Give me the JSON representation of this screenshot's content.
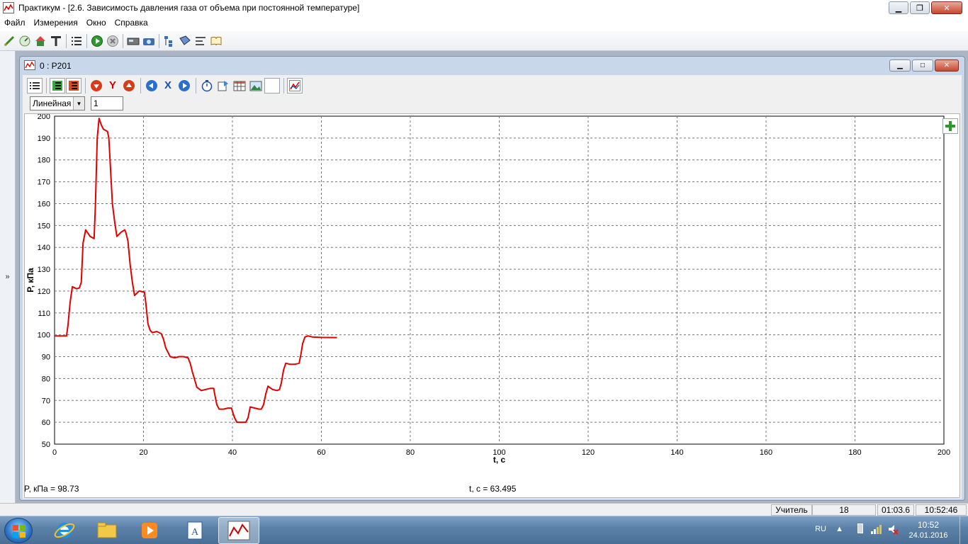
{
  "window": {
    "title": "Практикум - [2.6. Зависимость давления газа от объема при постоянной температуре]"
  },
  "menu": [
    "Файл",
    "Измерения",
    "Окно",
    "Справка"
  ],
  "leftbar": {
    "expand_label": "»"
  },
  "child": {
    "title": "0 : P201",
    "scale_select": "Линейная",
    "scale_value": "1"
  },
  "colors": {
    "line": "#e00000",
    "mdi_bg": "#abb5c3",
    "child_frame": "#c8d7ea"
  },
  "chart_data": {
    "type": "line",
    "xlabel": "t, c",
    "ylabel": "P, кПа",
    "xlim": [
      0,
      200
    ],
    "ylim": [
      50,
      200
    ],
    "grid": true,
    "x_ticks": [
      0,
      20,
      40,
      60,
      80,
      100,
      120,
      140,
      160,
      180,
      200
    ],
    "y_ticks": [
      50,
      60,
      70,
      80,
      90,
      100,
      110,
      120,
      130,
      140,
      150,
      160,
      170,
      180,
      190,
      200
    ],
    "series": [
      {
        "color": "#e00000",
        "x": [
          0,
          2.7,
          3,
          3.5,
          4,
          5,
          5.6,
          6,
          6.4,
          7,
          8,
          8.9,
          9.2,
          9.6,
          10,
          10.5,
          11,
          11.9,
          12.2,
          12.6,
          13,
          13.5,
          14,
          15,
          15.8,
          16,
          16.5,
          17,
          17.5,
          18,
          18.5,
          19,
          20.2,
          20.5,
          21,
          21.5,
          22,
          23,
          24,
          24.5,
          25,
          26,
          27,
          28,
          29,
          30,
          30.5,
          31,
          32,
          33,
          34,
          35,
          35.8,
          36,
          36.5,
          37,
          38,
          39,
          39.8,
          40,
          40.5,
          41,
          42,
          43,
          43.5,
          44,
          45,
          46,
          46.5,
          47,
          47.5,
          48,
          49,
          50,
          50.6,
          51,
          51.5,
          52,
          53,
          54,
          55,
          55.4,
          55.8,
          56.3,
          57,
          58,
          60,
          63.5
        ],
        "y": [
          99.5,
          99.5,
          104,
          115,
          122,
          121,
          121.5,
          124,
          142,
          148,
          145,
          144,
          160,
          190,
          199,
          196,
          194,
          193,
          190,
          175,
          160,
          152,
          145,
          147,
          148,
          147,
          143,
          132,
          124,
          118,
          119,
          120,
          119.5,
          115,
          105,
          102,
          101,
          101.5,
          100.5,
          98,
          94,
          90,
          89.5,
          90,
          90,
          89.5,
          87,
          83,
          76,
          74.5,
          75,
          75.5,
          75.5,
          73,
          68,
          66,
          66,
          66.5,
          66.5,
          65,
          62,
          60,
          60,
          60,
          62,
          67,
          66.5,
          66,
          66,
          68,
          73,
          76.5,
          75,
          74.5,
          75,
          78,
          84,
          87,
          86.5,
          86.5,
          87,
          91,
          96,
          99,
          99.5,
          99,
          98.8,
          98.73
        ]
      }
    ]
  },
  "readouts": {
    "y_value": "P, кПа = 98.73",
    "x_value": "t, c = 63.495"
  },
  "statusbar": {
    "user": "Учитель",
    "count": "18",
    "elapsed": "01:03.6",
    "clock": "10:52:46"
  },
  "taskbar": {
    "language": "RU",
    "time": "10:52",
    "date": "24.01.2016"
  }
}
